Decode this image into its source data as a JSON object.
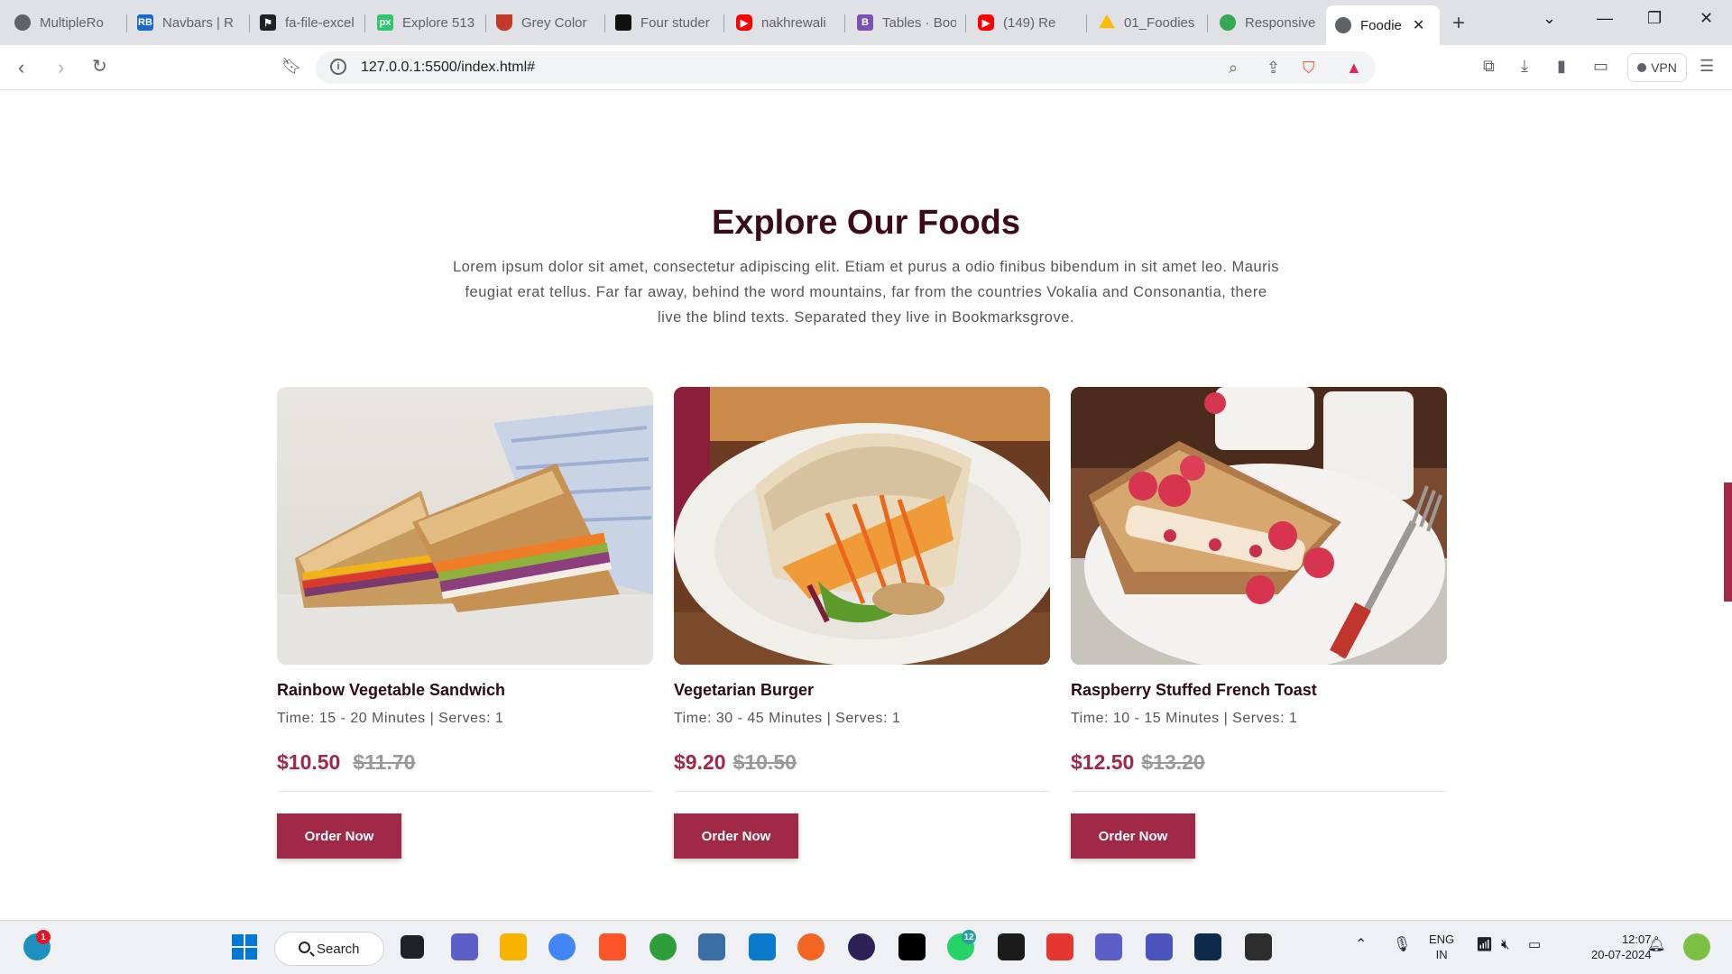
{
  "browser": {
    "tabs": [
      {
        "title": "MultipleRo",
        "icon": "globe-icon",
        "color": "#5f6368"
      },
      {
        "title": "Navbars | R",
        "icon": "react-bootstrap-icon",
        "color": "#1b6ac9"
      },
      {
        "title": "fa-file-excel",
        "icon": "flag-icon",
        "color": "#202124"
      },
      {
        "title": "Explore 513",
        "icon": "pixabay-icon",
        "color": "#2ec66d"
      },
      {
        "title": "Grey Color",
        "icon": "cup-icon",
        "color": "#c0392b"
      },
      {
        "title": "Four studer",
        "icon": "square-icon",
        "color": "#111111"
      },
      {
        "title": "nakhrewali",
        "icon": "youtube-icon",
        "color": "#ff0000"
      },
      {
        "title": "Tables · Boo",
        "icon": "bootstrap-icon",
        "color": "#7952b3"
      },
      {
        "title": "(149) Re",
        "icon": "youtube-icon",
        "color": "#ff0000"
      },
      {
        "title": "01_Foodies",
        "icon": "drive-icon",
        "color": "#fbbc04"
      },
      {
        "title": "Responsive",
        "icon": "leaf-icon",
        "color": "#34a853"
      },
      {
        "title": "Foodie",
        "icon": "globe-icon",
        "color": "#5f6368"
      }
    ],
    "url": "127.0.0.1:5500/index.html#",
    "vpn_label": "VPN"
  },
  "section": {
    "title": "Explore Our Foods",
    "description": "Lorem ipsum dolor sit amet, consectetur adipiscing elit. Etiam et purus a odio finibus bibendum in sit amet leo. Mauris feugiat erat tellus. Far far away, behind the word mountains, far from the countries Vokalia and Consonantia, there live the blind texts. Separated they live in Bookmarksgrove."
  },
  "foods": [
    {
      "name": "Rainbow Vegetable Sandwich",
      "meta": "Time: 15 - 20 Minutes | Serves: 1",
      "price": "$10.50",
      "old_price": "$11.70",
      "button": "Order Now"
    },
    {
      "name": "Vegetarian Burger",
      "meta": "Time: 30 - 45 Minutes | Serves: 1",
      "price": "$9.20",
      "old_price": "$10.50",
      "button": "Order Now"
    },
    {
      "name": "Raspberry Stuffed French Toast",
      "meta": "Time: 10 - 15 Minutes | Serves: 1",
      "price": "$12.50",
      "old_price": "$13.20",
      "button": "Order Now"
    }
  ],
  "colors": {
    "accent": "#a0294a",
    "heading": "#3a0b18"
  },
  "taskbar": {
    "search_label": "Search",
    "lang_top": "ENG",
    "lang_bottom": "IN",
    "time": "12:07",
    "date": "20-07-2024",
    "widget_badge": "1",
    "whatsapp_badge": "12"
  }
}
